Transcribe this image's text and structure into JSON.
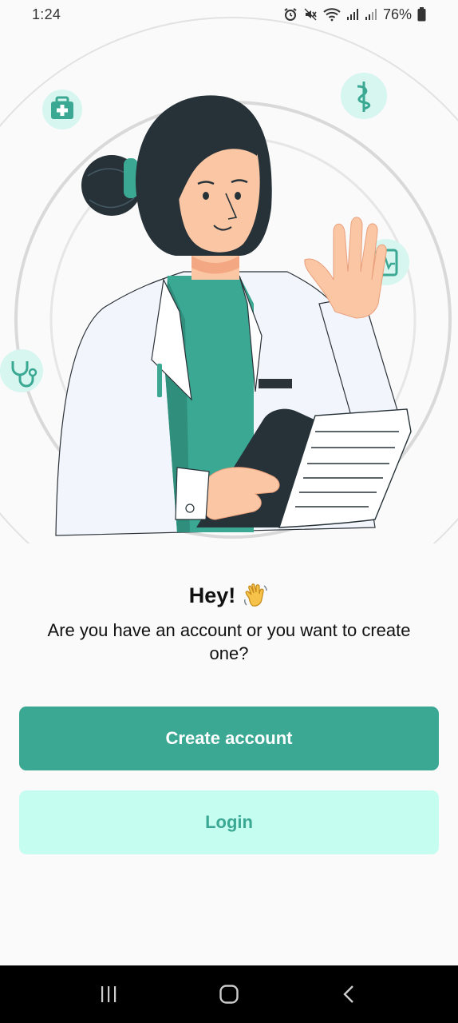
{
  "status_bar": {
    "time": "1:24",
    "battery_percent": "76%",
    "icons": [
      "alarm-icon",
      "mute-icon",
      "wifi-icon",
      "signal-icon",
      "signal-icon-2",
      "battery-icon"
    ]
  },
  "hero": {
    "illustration": "doctor-waving-illustration",
    "floating_icons": [
      "medical-kit-icon",
      "caduceus-icon",
      "health-report-icon",
      "stethoscope-icon"
    ]
  },
  "greeting": {
    "title": "Hey!",
    "emoji_icon": "waving-hand-icon",
    "subtitle": "Are you have an account or you want to create one?"
  },
  "actions": {
    "create_account_label": "Create account",
    "login_label": "Login"
  },
  "nav_bar": {
    "buttons": [
      "recent-apps-icon",
      "home-icon",
      "back-icon"
    ]
  },
  "colors": {
    "primary": "#3aa893",
    "primary_light": "#c6fdf1",
    "background": "#fafafa",
    "text": "#111111"
  }
}
